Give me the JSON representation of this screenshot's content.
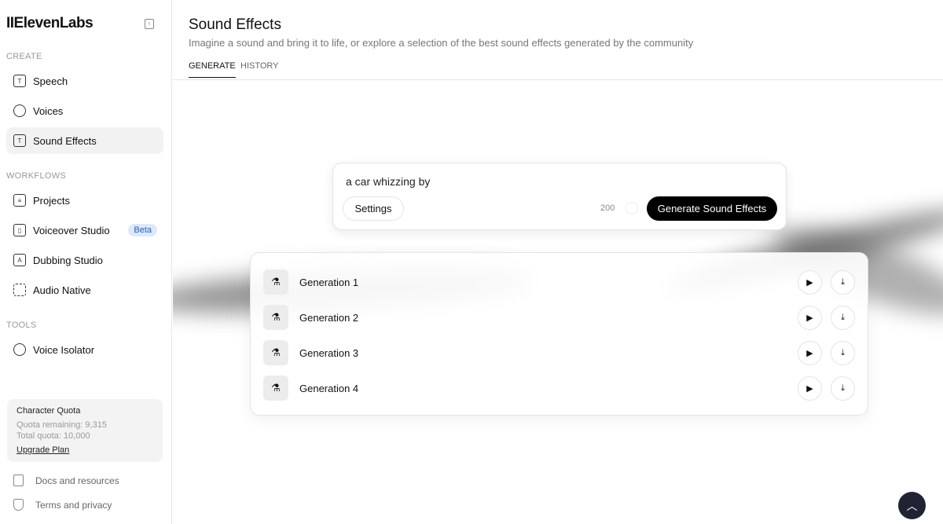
{
  "sidebar": {
    "logo": "IIElevenLabs",
    "sections": {
      "create": "CREATE",
      "workflows": "WORKFLOWS",
      "tools": "TOOLS"
    },
    "items": [
      {
        "label": "Speech",
        "icon": "speech-icon"
      },
      {
        "label": "Voices",
        "icon": "voices-icon"
      },
      {
        "label": "Sound Effects",
        "icon": "sound-effects-icon",
        "active": true
      },
      {
        "label": "Projects",
        "icon": "projects-icon"
      },
      {
        "label": "Voiceover Studio",
        "icon": "voiceover-icon",
        "badge": "Beta"
      },
      {
        "label": "Dubbing Studio",
        "icon": "dubbing-icon"
      },
      {
        "label": "Audio Native",
        "icon": "audio-native-icon"
      },
      {
        "label": "Voice Isolator",
        "icon": "voice-isolator-icon"
      }
    ],
    "quota": {
      "title": "Character Quota",
      "remaining": "Quota remaining: 9,315",
      "total": "Total quota: 10,000",
      "upgrade": "Upgrade Plan"
    },
    "footer": [
      {
        "label": "Docs and resources",
        "icon": "book-icon"
      },
      {
        "label": "Terms and privacy",
        "icon": "shield-icon"
      }
    ]
  },
  "header": {
    "title": "Sound Effects",
    "subtitle": "Imagine a sound and bring it to life, or explore a selection of the best sound effects generated by the community",
    "tabs": [
      {
        "label": "GENERATE",
        "active": true
      },
      {
        "label": "HISTORY"
      }
    ]
  },
  "prompt": {
    "value": "a car whizzing by",
    "settings": "Settings",
    "char_count": "200",
    "generate": "Generate Sound Effects"
  },
  "generations": [
    {
      "label": "Generation 1"
    },
    {
      "label": "Generation 2"
    },
    {
      "label": "Generation 3"
    },
    {
      "label": "Generation 4"
    }
  ],
  "colors": {
    "accent": "#000000",
    "badge_bg": "#dce9fb",
    "scroll_button": "#1f2333"
  }
}
